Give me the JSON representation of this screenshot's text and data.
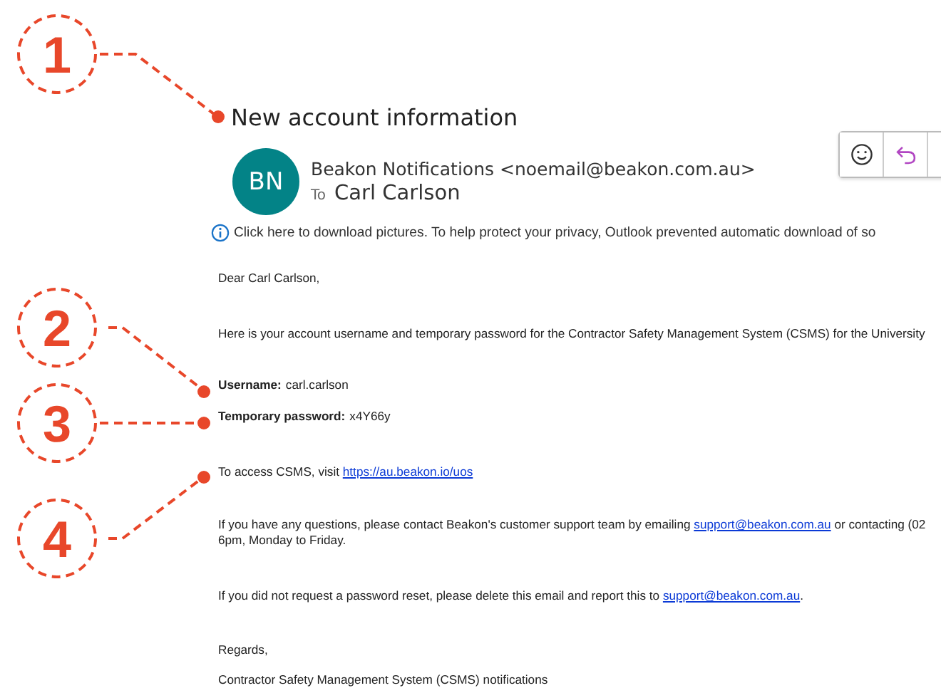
{
  "callouts": [
    {
      "number": "1"
    },
    {
      "number": "2"
    },
    {
      "number": "3"
    },
    {
      "number": "4"
    }
  ],
  "message": {
    "subject": "New account information",
    "sender": {
      "initials": "BN",
      "name": "Beakon Notifications <noemail@beakon.com.au>",
      "to_label": "To",
      "recipient": "Carl Carlson"
    },
    "info_bar": "Click here to download pictures. To help protect your privacy, Outlook prevented automatic download of so",
    "body": [
      {
        "kind": "text",
        "lines": [
          [
            "Dear Carl Carlson,"
          ]
        ]
      },
      {
        "kind": "text",
        "lines": [
          [
            "Here is your account username and temporary password for the Contractor Safety Management System (CSMS) for the University"
          ]
        ]
      },
      {
        "kind": "field",
        "label": "Username:",
        "value": "carl.carlson"
      },
      {
        "kind": "field",
        "label": "Temporary password:",
        "value": "x4Y66y"
      },
      {
        "kind": "text",
        "lines": [
          [
            "To access CSMS, visit ",
            {
              "link": "https://au.beakon.io/uos"
            }
          ]
        ]
      },
      {
        "kind": "text",
        "lines": [
          [
            "If you have any questions, please contact Beakon's customer support team by emailing ",
            {
              "link": "support@beakon.com.au"
            },
            " or contacting (02"
          ],
          [
            "6pm, Monday to Friday."
          ]
        ]
      },
      {
        "kind": "text",
        "lines": [
          [
            "If you did not request a password reset, please delete this email and report this to ",
            {
              "link": "support@beakon.com.au"
            },
            "."
          ]
        ]
      },
      {
        "kind": "text",
        "lines": [
          [
            "Regards,"
          ]
        ]
      },
      {
        "kind": "text",
        "lines": [
          [
            "Contractor Safety Management System (CSMS) notifications"
          ]
        ]
      }
    ]
  }
}
